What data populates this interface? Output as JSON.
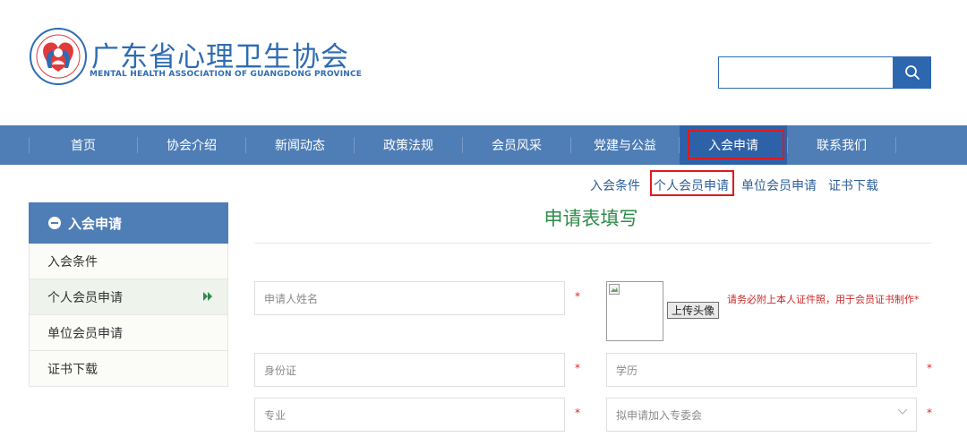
{
  "header": {
    "org_name": "广东省心理卫生协会",
    "org_name_en": "MENTAL HEALTH ASSOCIATION OF GUANGDONG PROVINCE",
    "logo_icon": "association-logo-icon",
    "search": {
      "placeholder": "",
      "icon": "search-icon"
    }
  },
  "nav": {
    "items": [
      {
        "label": "首页"
      },
      {
        "label": "协会介绍"
      },
      {
        "label": "新闻动态"
      },
      {
        "label": "政策法规"
      },
      {
        "label": "会员风采"
      },
      {
        "label": "党建与公益"
      },
      {
        "label": "入会申请"
      },
      {
        "label": "联系我们"
      }
    ],
    "active_index": 6
  },
  "sublinks": [
    {
      "label": "入会条件"
    },
    {
      "label": "个人会员申请"
    },
    {
      "label": "单位会员申请"
    },
    {
      "label": "证书下载"
    }
  ],
  "sidebar": {
    "title": "入会申请",
    "items": [
      {
        "label": "入会条件"
      },
      {
        "label": "个人会员申请"
      },
      {
        "label": "单位会员申请"
      },
      {
        "label": "证书下载"
      }
    ],
    "active_index": 1
  },
  "main": {
    "title": "申请表填写",
    "form": {
      "name_placeholder": "申请人姓名",
      "id_placeholder": "身份证",
      "education_placeholder": "学历",
      "major_placeholder": "专业",
      "committee_placeholder": "拟申请加入专委会",
      "required_mark": "*",
      "upload_label": "上传头像",
      "photo_note": "请务必附上本人证件照，用于会员证书制作*"
    }
  },
  "colors": {
    "brand_blue": "#2e6cb2",
    "nav_bg": "#4f7db5",
    "title_green": "#2e8b4a",
    "highlight_red": "#e0191e"
  }
}
